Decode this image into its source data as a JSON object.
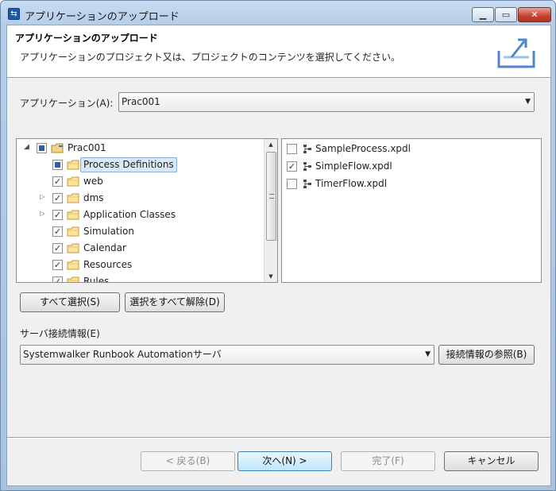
{
  "window": {
    "title": "アプリケーションのアップロード"
  },
  "banner": {
    "title": "アプリケーションのアップロード",
    "description": "アプリケーションのプロジェクト又は、プロジェクトのコンテンツを選択してください。",
    "icon": "upload-icon"
  },
  "application": {
    "label": "アプリケーション(A):",
    "value": "Prac001"
  },
  "tree": {
    "root": {
      "label": "Prac001",
      "expanded": true,
      "check": "partial"
    },
    "items": [
      {
        "label": "Process Definitions",
        "check": "partial",
        "selected": true,
        "expander": ""
      },
      {
        "label": "web",
        "check": "checked",
        "expander": ""
      },
      {
        "label": "dms",
        "check": "checked",
        "expander": "▷"
      },
      {
        "label": "Application Classes",
        "check": "checked",
        "expander": "▷"
      },
      {
        "label": "Simulation",
        "check": "checked",
        "expander": ""
      },
      {
        "label": "Calendar",
        "check": "checked",
        "expander": ""
      },
      {
        "label": "Resources",
        "check": "checked",
        "expander": ""
      },
      {
        "label": "Rules",
        "check": "checked",
        "expander": ""
      }
    ]
  },
  "files": {
    "items": [
      {
        "label": "SampleProcess.xpdl",
        "checked": false
      },
      {
        "label": "SimpleFlow.xpdl",
        "checked": true
      },
      {
        "label": "TimerFlow.xpdl",
        "checked": false
      }
    ]
  },
  "buttons": {
    "select_all": "すべて選択(S)",
    "deselect_all": "選択をすべて解除(D)",
    "browse_connection": "接続情報の参照(B)",
    "back": "< 戻る(B)",
    "next": "次へ(N) >",
    "finish": "完了(F)",
    "cancel": "キャンセル"
  },
  "server": {
    "label": "サーバ接続情報(E)",
    "value": "Systemwalker Runbook Automationサーバ"
  }
}
